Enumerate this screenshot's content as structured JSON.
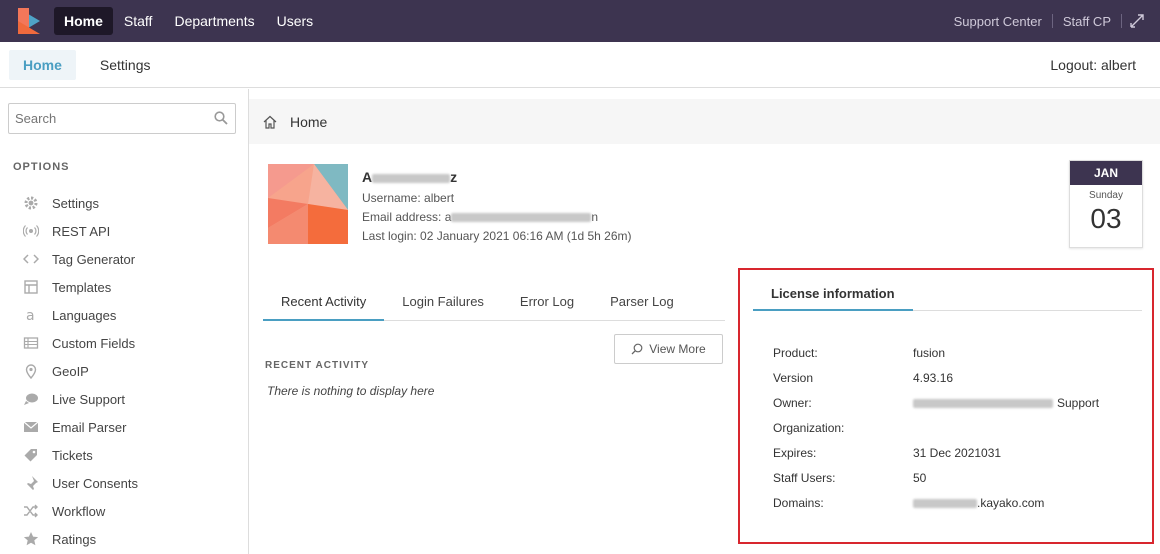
{
  "topnav": {
    "items": [
      "Home",
      "Staff",
      "Departments",
      "Users"
    ],
    "support_center": "Support Center",
    "staff_cp": "Staff CP"
  },
  "subnav": {
    "tabs": [
      "Home",
      "Settings"
    ],
    "logout": "Logout: albert"
  },
  "sidebar": {
    "search_placeholder": "Search",
    "options_heading": "OPTIONS",
    "items": [
      {
        "label": "Settings",
        "icon": "gear-icon"
      },
      {
        "label": "REST API",
        "icon": "broadcast-icon"
      },
      {
        "label": "Tag Generator",
        "icon": "code-icon"
      },
      {
        "label": "Templates",
        "icon": "template-icon"
      },
      {
        "label": "Languages",
        "icon": "language-icon"
      },
      {
        "label": "Custom Fields",
        "icon": "fields-icon"
      },
      {
        "label": "GeoIP",
        "icon": "map-pin-icon"
      },
      {
        "label": "Live Support",
        "icon": "chat-icon"
      },
      {
        "label": "Email Parser",
        "icon": "envelope-icon"
      },
      {
        "label": "Tickets",
        "icon": "tag-icon"
      },
      {
        "label": "User Consents",
        "icon": "pin-icon"
      },
      {
        "label": "Workflow",
        "icon": "shuffle-icon"
      },
      {
        "label": "Ratings",
        "icon": "star-icon"
      }
    ]
  },
  "breadcrumb": {
    "label": "Home"
  },
  "profile": {
    "name_start": "A",
    "name_end": "z",
    "username": "Username: albert",
    "email_prefix": "Email address: a",
    "email_suffix": "n",
    "last_login": "Last login: 02 January 2021 06:16 AM (1d 5h 26m)"
  },
  "calendar": {
    "month": "JAN",
    "weekday": "Sunday",
    "day": "03"
  },
  "activity_tabs": [
    "Recent Activity",
    "Login Failures",
    "Error Log",
    "Parser Log"
  ],
  "view_more": "View More",
  "recent_activity": {
    "heading": "RECENT ACTIVITY",
    "empty": "There is nothing to display here"
  },
  "license": {
    "heading": "License information",
    "rows": [
      {
        "label": "Product:",
        "value": "fusion"
      },
      {
        "label": "Version",
        "value": "4.93.16"
      },
      {
        "label": "Owner:",
        "value": "Support"
      },
      {
        "label": "Organization:",
        "value": ""
      },
      {
        "label": "Expires:",
        "value": "31 Dec 2021031"
      },
      {
        "label": "Staff Users:",
        "value": "50"
      },
      {
        "label": "Domains:",
        "value": ".kayako.com"
      }
    ]
  },
  "colors": {
    "topbar": "#3d3450",
    "accent": "#4a9ec2",
    "highlight_border": "#d8262e"
  }
}
